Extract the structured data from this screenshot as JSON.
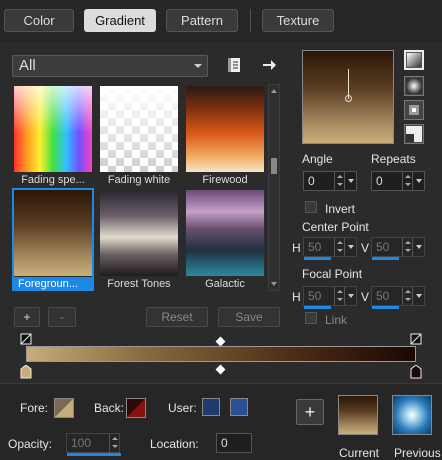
{
  "tabs": [
    {
      "label": "Color"
    },
    {
      "label": "Gradient"
    },
    {
      "label": "Pattern"
    },
    {
      "label": "Texture"
    }
  ],
  "filter": {
    "selected": "All"
  },
  "gradients": [
    {
      "label": "Fading spe..."
    },
    {
      "label": "Fading white"
    },
    {
      "label": "Firewood"
    },
    {
      "label": "Foregroun..."
    },
    {
      "label": "Forest Tones"
    },
    {
      "label": "Galactic"
    }
  ],
  "list_buttons": {
    "add": "+",
    "remove": "-",
    "reset": "Reset",
    "save": "Save"
  },
  "angle": {
    "label": "Angle",
    "value": "0"
  },
  "repeats": {
    "label": "Repeats",
    "value": "0"
  },
  "invert": {
    "label": "Invert",
    "checked": false
  },
  "center_point": {
    "label": "Center Point",
    "h_label": "H",
    "h_value": "50",
    "v_label": "V",
    "v_value": "50"
  },
  "focal_point": {
    "label": "Focal Point",
    "h_label": "H",
    "h_value": "50",
    "v_label": "V",
    "v_value": "50"
  },
  "link": {
    "label": "Link",
    "checked": false
  },
  "bottom": {
    "fore_label": "Fore:",
    "back_label": "Back:",
    "user_label": "User:",
    "opacity_label": "Opacity:",
    "opacity_value": "100",
    "location_label": "Location:",
    "location_value": "0",
    "current_label": "Current",
    "previous_label": "Previous",
    "add_label": "+"
  },
  "colors": {
    "accent": "#1e88e5",
    "user_swatch_1": "#1f3a6e",
    "user_swatch_2": "#2a4f94"
  },
  "icons": {
    "browse": "book-icon",
    "next": "arrow-right-icon"
  }
}
